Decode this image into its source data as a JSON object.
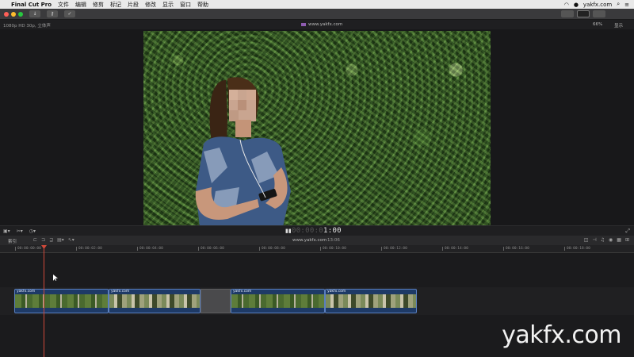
{
  "menubar": {
    "app_name": "Final Cut Pro",
    "items": [
      "文件",
      "编辑",
      "修剪",
      "标记",
      "片段",
      "修改",
      "显示",
      "窗口",
      "帮助"
    ],
    "right_text": "yakfx.com"
  },
  "viewer": {
    "format": "1080p HD 30p, 立体声",
    "title": "www.yakfx.com",
    "zoom": "66%",
    "display_label": "显示"
  },
  "playback": {
    "timecode_dim": "00:00:0",
    "timecode_bright": "1:00"
  },
  "timeline": {
    "index_label": "索引",
    "project_name": "www.yakfx.com",
    "duration": "13:06",
    "ruler_ticks": [
      "00:00:00:00",
      "00:00:02:00",
      "00:00:04:00",
      "00:00:06:00",
      "00:00:08:00",
      "00:00:10:00",
      "00:00:12:00",
      "00:00:14:00",
      "00:00:16:00",
      "00:00:18:00"
    ],
    "clips": [
      {
        "name": "yakfx.com"
      },
      {
        "name": "yakfx.com"
      },
      {
        "name": "yakfx.com"
      },
      {
        "name": "yakfx.com"
      }
    ]
  },
  "watermark": "yakfx.com",
  "colors": {
    "playhead": "#d0493a",
    "clip_fill": "#1e3a66",
    "clip_border": "#5a7fbf"
  }
}
